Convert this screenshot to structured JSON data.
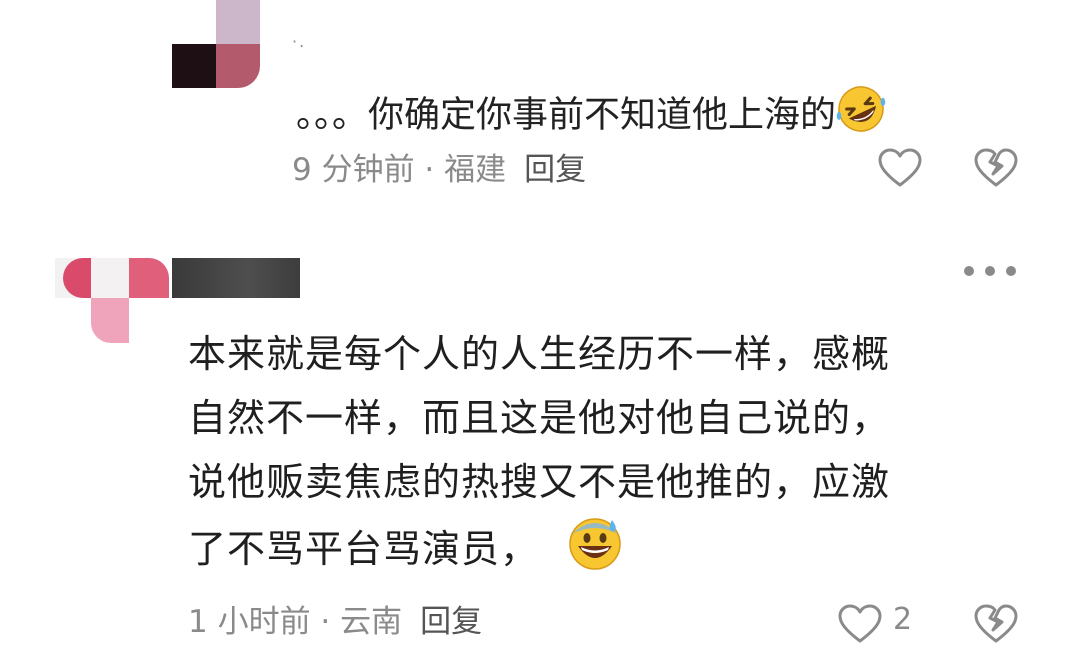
{
  "reply": {
    "name": "·.",
    "text": "。。。你确定你事前不知道他上海的",
    "meta_time": "9 分钟前 · 福建",
    "reply_label": "回复",
    "emoji": "rolling-on-floor-laughing-emoji"
  },
  "comment": {
    "text_lines": [
      "本来就是每个人的人生经历不一样，感概",
      "自然不一样，而且这是他对他自己说的，",
      "说他贩卖焦虑的热搜又不是他推的，应激",
      "了不骂平台骂演员，"
    ],
    "emoji": "grinning-sweat-emoji",
    "meta_time": "1 小时前 · 云南",
    "reply_label": "回复",
    "like_count": "2"
  },
  "icons": {
    "like": "heart-icon",
    "dislike": "broken-heart-icon",
    "more": "more-dots-icon"
  },
  "colors": {
    "text": "#1f1f1f",
    "meta": "#8a8a8a",
    "icon": "#8a8a8a",
    "background": "#ffffff"
  }
}
